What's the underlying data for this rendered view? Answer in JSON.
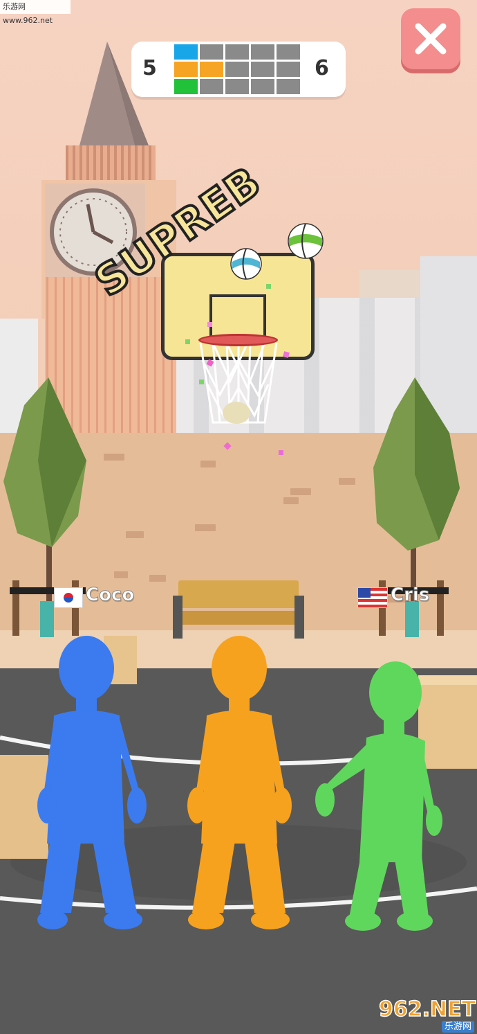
{
  "watermark_top": "乐游网 www.962.net",
  "scoreboard": {
    "left_score": "5",
    "right_score": "6",
    "rows": [
      [
        "#19a6e8",
        "#8a8a8a",
        "#8a8a8a",
        "#8a8a8a",
        "#8a8a8a"
      ],
      [
        "#f6a423",
        "#f6a423",
        "#8a8a8a",
        "#8a8a8a",
        "#8a8a8a"
      ],
      [
        "#21c23a",
        "#8a8a8a",
        "#8a8a8a",
        "#8a8a8a",
        "#8a8a8a"
      ]
    ]
  },
  "close_button": {
    "icon": "close-icon"
  },
  "feedback_text": "SUPREB",
  "players": {
    "left_name": "Coco",
    "left_flag": "south-korea-flag-icon",
    "right_name": "Cris",
    "right_flag": "usa-flag-icon"
  },
  "characters": [
    {
      "name": "blue-character",
      "color": "#3b7bef"
    },
    {
      "name": "orange-character",
      "color": "#f7a21e"
    },
    {
      "name": "green-character",
      "color": "#5fd75c"
    }
  ],
  "balls": [
    {
      "name": "teal-basketball",
      "color": "#4fb5d3"
    },
    {
      "name": "green-basketball",
      "color": "#6cc23a"
    }
  ],
  "watermark_bottom": {
    "main": "962.NET",
    "sub": "乐游网"
  }
}
